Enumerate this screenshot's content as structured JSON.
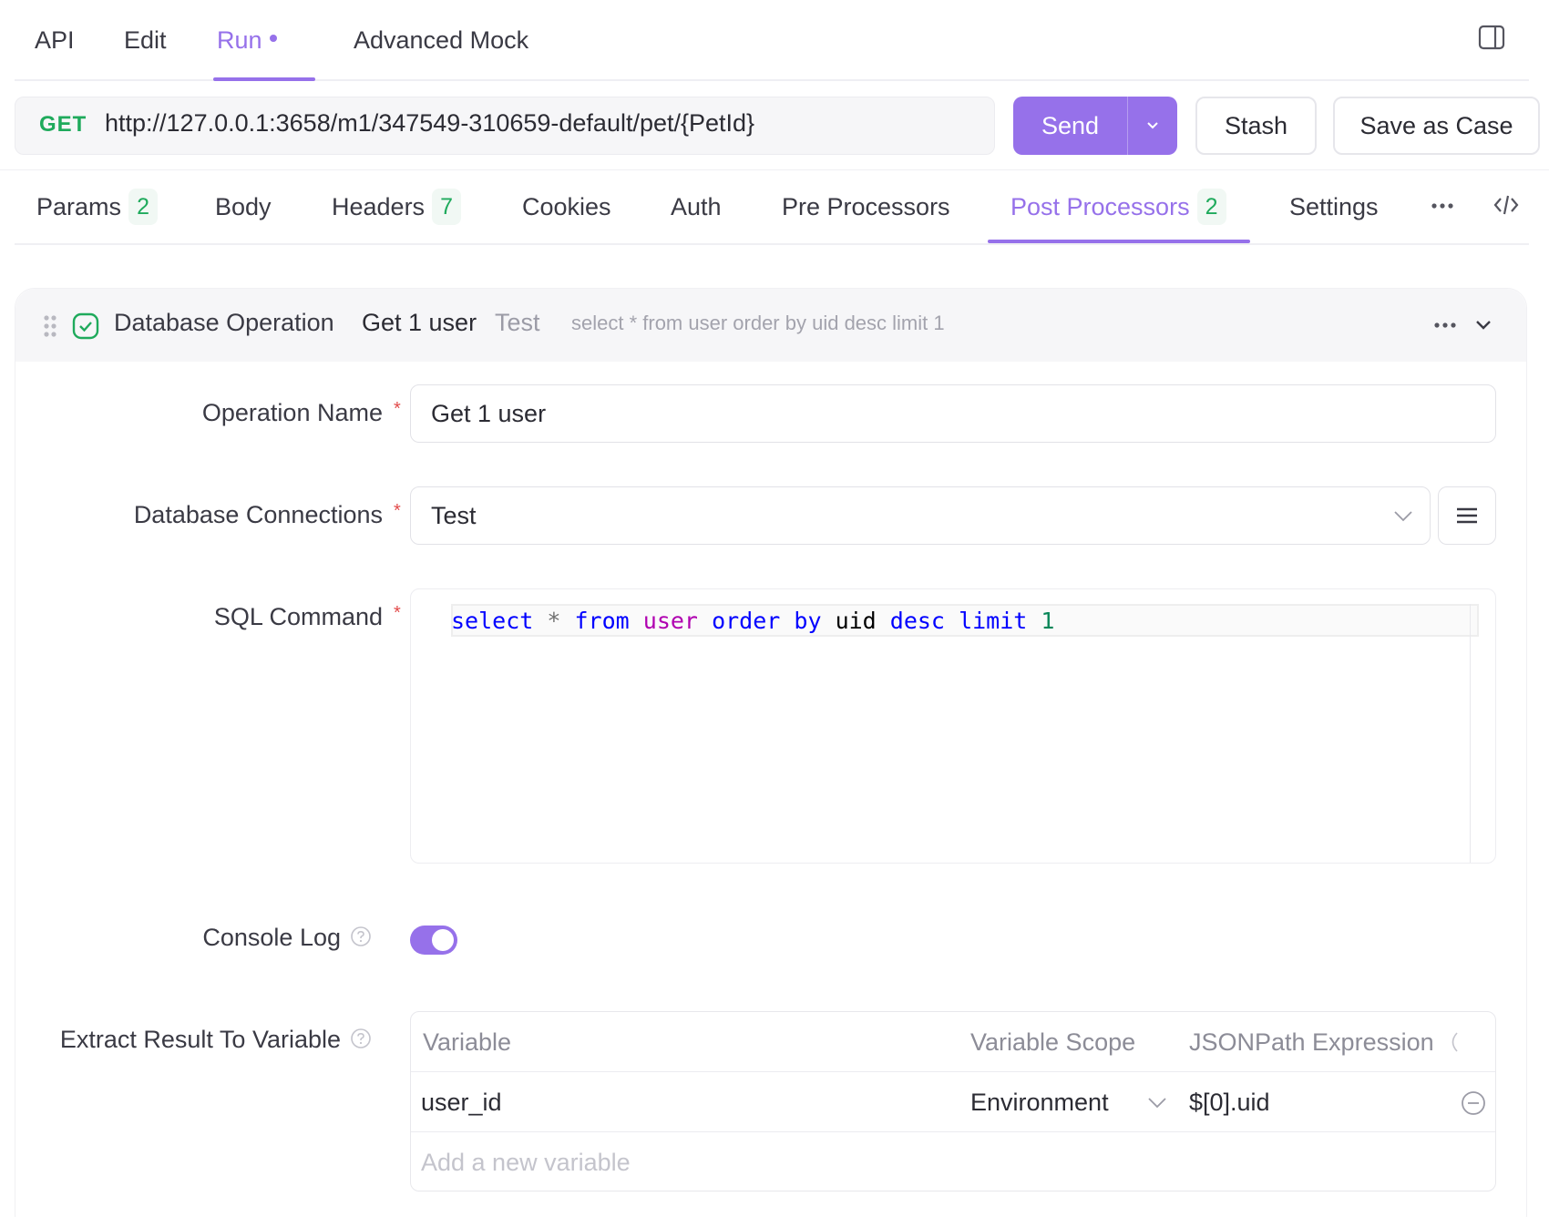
{
  "top_tabs": {
    "api": "API",
    "edit": "Edit",
    "run": "Run",
    "advanced_mock": "Advanced Mock"
  },
  "request": {
    "method": "GET",
    "url": "http://127.0.0.1:3658/m1/347549-310659-default/pet/{PetId}",
    "send_label": "Send",
    "stash_label": "Stash",
    "save_case_label": "Save as Case"
  },
  "req_tabs": {
    "params": "Params",
    "params_count": "2",
    "body": "Body",
    "headers": "Headers",
    "headers_count": "7",
    "cookies": "Cookies",
    "auth": "Auth",
    "pre_processors": "Pre Processors",
    "post_processors": "Post Processors",
    "post_processors_count": "2",
    "settings": "Settings"
  },
  "processor": {
    "type": "Database Operation",
    "name": "Get 1 user",
    "connection": "Test",
    "sql_summary": "select * from user order by uid desc limit 1"
  },
  "form": {
    "operation_name_label": "Operation Name",
    "operation_name_value": "Get 1 user",
    "db_connections_label": "Database Connections",
    "db_connections_value": "Test",
    "sql_command_label": "SQL Command",
    "sql_tokens": {
      "select": "select",
      "star": "*",
      "from": "from",
      "table": "user",
      "order": "order",
      "by": "by",
      "column": "uid",
      "desc": "desc",
      "limit": "limit",
      "number": "1"
    },
    "console_log_label": "Console Log",
    "console_log_enabled": true,
    "extract_label": "Extract Result To Variable"
  },
  "variables_table": {
    "headers": {
      "variable": "Variable",
      "scope": "Variable Scope",
      "jsonpath": "JSONPath Expression"
    },
    "rows": [
      {
        "variable": "user_id",
        "scope": "Environment",
        "jsonpath": "$[0].uid"
      }
    ],
    "add_placeholder": "Add a new variable"
  },
  "colors": {
    "accent": "#9671ea",
    "method_get": "#1faa5c",
    "required": "#e24b4b"
  }
}
